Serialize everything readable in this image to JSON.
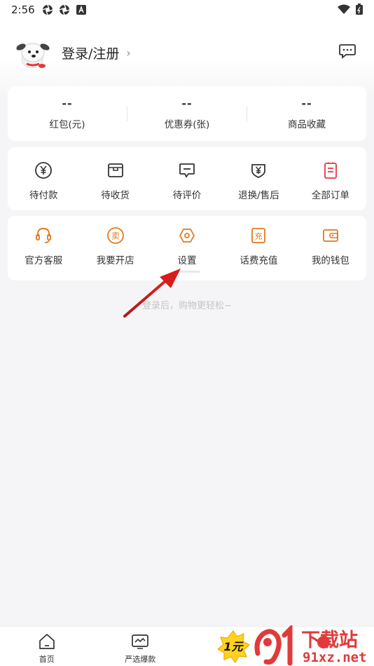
{
  "status_bar": {
    "time": "2:56"
  },
  "header": {
    "login_label": "登录/注册",
    "chevron": "›"
  },
  "stats": [
    {
      "value": "--",
      "label": "红包(元)"
    },
    {
      "value": "--",
      "label": "优惠券(张)"
    },
    {
      "value": "--",
      "label": "商品收藏"
    }
  ],
  "orders": [
    {
      "icon": "yen-circle-icon",
      "label": "待付款"
    },
    {
      "icon": "box-icon",
      "label": "待收货"
    },
    {
      "icon": "comment-icon",
      "label": "待评价"
    },
    {
      "icon": "refund-icon",
      "label": "退换/售后"
    },
    {
      "icon": "order-list-icon",
      "label": "全部订单"
    }
  ],
  "services": [
    {
      "icon": "headset-icon",
      "label": "官方客服"
    },
    {
      "icon": "shop-sell-icon",
      "label": "我要开店"
    },
    {
      "icon": "hexagon-settings-icon",
      "label": "设置"
    },
    {
      "icon": "recharge-icon",
      "label": "话费充值"
    },
    {
      "icon": "wallet-icon",
      "label": "我的钱包"
    }
  ],
  "hint": "登录后，购物更轻松~",
  "bottom_nav": [
    {
      "icon": "home-icon",
      "label": "首页"
    },
    {
      "icon": "tv-icon",
      "label": "严选爆款"
    }
  ],
  "promo_badge": {
    "text": "1元"
  },
  "watermark": {
    "title": "下载站",
    "url": "91xz.net"
  },
  "colors": {
    "accent_orange": "#e07a1f",
    "accent_red": "#e4393c",
    "icon_dark": "#333333"
  }
}
